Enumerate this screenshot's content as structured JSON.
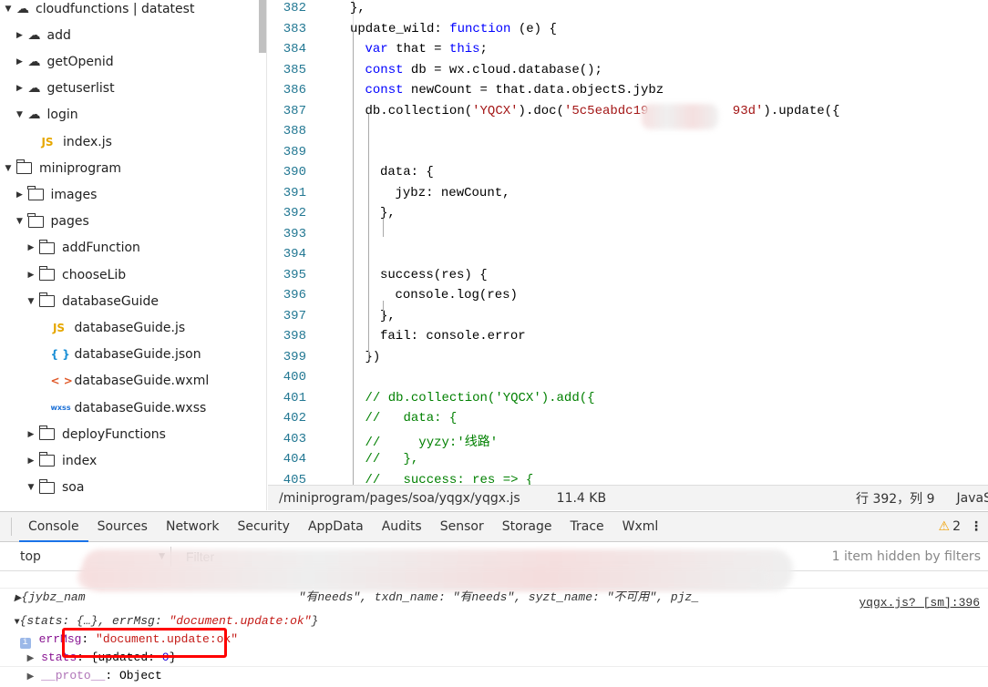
{
  "sidebar": {
    "items": [
      {
        "label": "cloudfunctions | datatest",
        "type": "cloud-folder",
        "depth": 0,
        "expanded": true
      },
      {
        "label": "add",
        "type": "cloud",
        "depth": 1,
        "expanded": false
      },
      {
        "label": "getOpenid",
        "type": "cloud",
        "depth": 1,
        "expanded": false
      },
      {
        "label": "getuserlist",
        "type": "cloud",
        "depth": 1,
        "expanded": false
      },
      {
        "label": "login",
        "type": "cloud",
        "depth": 1,
        "expanded": true
      },
      {
        "label": "index.js",
        "type": "js",
        "depth": 2
      },
      {
        "label": "miniprogram",
        "type": "folder",
        "depth": 0,
        "expanded": true
      },
      {
        "label": "images",
        "type": "folder",
        "depth": 1,
        "expanded": false
      },
      {
        "label": "pages",
        "type": "folder",
        "depth": 1,
        "expanded": true
      },
      {
        "label": "addFunction",
        "type": "folder",
        "depth": 2,
        "expanded": false
      },
      {
        "label": "chooseLib",
        "type": "folder",
        "depth": 2,
        "expanded": false
      },
      {
        "label": "databaseGuide",
        "type": "folder",
        "depth": 2,
        "expanded": true
      },
      {
        "label": "databaseGuide.js",
        "type": "js",
        "depth": 3
      },
      {
        "label": "databaseGuide.json",
        "type": "json",
        "depth": 3
      },
      {
        "label": "databaseGuide.wxml",
        "type": "wxml",
        "depth": 3
      },
      {
        "label": "databaseGuide.wxss",
        "type": "wxss",
        "depth": 3
      },
      {
        "label": "deployFunctions",
        "type": "folder",
        "depth": 2,
        "expanded": false
      },
      {
        "label": "index",
        "type": "folder",
        "depth": 2,
        "expanded": false
      },
      {
        "label": "soa",
        "type": "folder",
        "depth": 2,
        "expanded": true
      }
    ],
    "icons": {
      "js": "JS",
      "json": "{ }",
      "wxml": "< >",
      "wxss": "wxss"
    }
  },
  "editor": {
    "lines": [
      {
        "n": "382",
        "indent": 0,
        "parts": [
          [
            "},",
            ""
          ]
        ]
      },
      {
        "n": "383",
        "indent": 0,
        "parts": [
          [
            "update_wild: ",
            ""
          ],
          [
            "function",
            "kw"
          ],
          [
            " (e) {",
            ""
          ]
        ]
      },
      {
        "n": "384",
        "indent": 1,
        "parts": [
          [
            "var",
            "kw"
          ],
          [
            " that = ",
            ""
          ],
          [
            "this",
            "kw"
          ],
          [
            ";",
            ""
          ]
        ]
      },
      {
        "n": "385",
        "indent": 1,
        "parts": [
          [
            "const",
            "kw"
          ],
          [
            " db = wx.cloud.database();",
            ""
          ]
        ]
      },
      {
        "n": "386",
        "indent": 1,
        "parts": [
          [
            "const",
            "kw"
          ],
          [
            " newCount = that.data.objectS.jybz",
            ""
          ]
        ]
      },
      {
        "n": "387",
        "indent": 1,
        "parts": [
          [
            "db.collection(",
            ""
          ],
          [
            "'YQCX'",
            "str"
          ],
          [
            ").doc(",
            ""
          ],
          [
            "'5c5eabdc19           93d'",
            "str"
          ],
          [
            ").update({",
            ""
          ]
        ]
      },
      {
        "n": "388",
        "indent": 2,
        "parts": []
      },
      {
        "n": "389",
        "indent": 2,
        "parts": []
      },
      {
        "n": "390",
        "indent": 2,
        "parts": [
          [
            "data: {",
            ""
          ]
        ]
      },
      {
        "n": "391",
        "indent": 3,
        "parts": [
          [
            "jybz: newCount,",
            ""
          ]
        ]
      },
      {
        "n": "392",
        "indent": 2,
        "parts": [
          [
            "},",
            ""
          ]
        ]
      },
      {
        "n": "393",
        "indent": 2,
        "parts": []
      },
      {
        "n": "394",
        "indent": 2,
        "parts": []
      },
      {
        "n": "395",
        "indent": 2,
        "parts": [
          [
            "success(res) {",
            ""
          ]
        ]
      },
      {
        "n": "396",
        "indent": 3,
        "parts": [
          [
            "console.log(res)",
            ""
          ]
        ]
      },
      {
        "n": "397",
        "indent": 2,
        "parts": [
          [
            "},",
            ""
          ]
        ]
      },
      {
        "n": "398",
        "indent": 2,
        "parts": [
          [
            "fail: console.error",
            ""
          ]
        ]
      },
      {
        "n": "399",
        "indent": 1,
        "parts": [
          [
            "})",
            ""
          ]
        ]
      },
      {
        "n": "400",
        "indent": 1,
        "parts": []
      },
      {
        "n": "401",
        "indent": 1,
        "parts": [
          [
            "// db.collection('YQCX').add({",
            "cm"
          ]
        ]
      },
      {
        "n": "402",
        "indent": 1,
        "parts": [
          [
            "//   data: {",
            "cm"
          ]
        ]
      },
      {
        "n": "403",
        "indent": 1,
        "parts": [
          [
            "//     yyzy:'线路'",
            "cm"
          ]
        ]
      },
      {
        "n": "404",
        "indent": 1,
        "parts": [
          [
            "//   },",
            "cm"
          ]
        ]
      },
      {
        "n": "405",
        "indent": 1,
        "parts": [
          [
            "//   success: res => {",
            "cm"
          ]
        ]
      }
    ]
  },
  "status": {
    "path": "/miniprogram/pages/soa/yqgx/yqgx.js",
    "size": "11.4 KB",
    "position": "行 392，列 9",
    "language": "JavaS"
  },
  "devtools": {
    "tabs": [
      "Console",
      "Sources",
      "Network",
      "Security",
      "AppData",
      "Audits",
      "Sensor",
      "Storage",
      "Trace",
      "Wxml"
    ],
    "active_tab": "Console",
    "warning_count": "2",
    "context": "top",
    "filter_placeholder": "Filter",
    "hidden_note": "1 item hidden by filters"
  },
  "console": {
    "line1": "{jybz_nam                              \"有needs\", txdn_name: \"有needs\", syzt_name: \"不可用\", pjz_",
    "line2_prefix": "{stats: {…}, errMsg: ",
    "line2_msg": "\"document.update:ok\"",
    "line2_suffix": "}",
    "source": "yqgx.js? [sm]:396",
    "errmsg_key": "errMsg",
    "errmsg_val": "\"document.update:ok\"",
    "stats_key": "stats",
    "stats_prefix": "{updated: ",
    "stats_val": "0",
    "stats_suffix": "}",
    "proto_key": "__proto__",
    "proto_val": "Object",
    "highlight_color": "#ff0000"
  }
}
